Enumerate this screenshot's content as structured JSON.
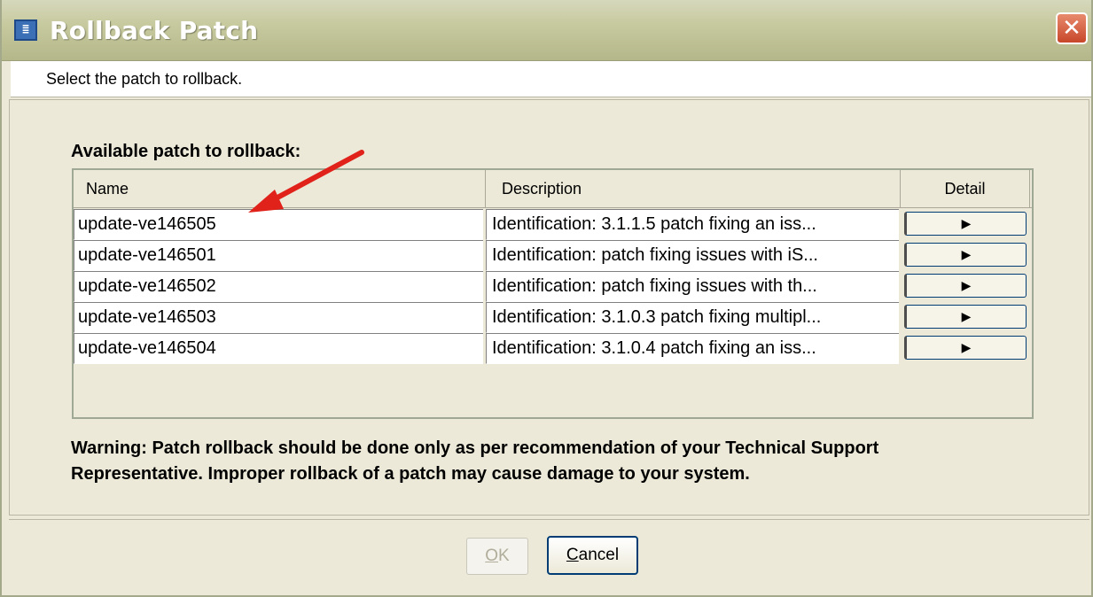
{
  "window": {
    "title": "Rollback Patch",
    "icon": "window-app-icon",
    "close_glyph": "✕"
  },
  "banner": {
    "text": "Select the patch to rollback."
  },
  "section": {
    "label": "Available patch to rollback:"
  },
  "table": {
    "columns": [
      "Name",
      "Description",
      "Detail"
    ],
    "rows": [
      {
        "name": "update-ve146505",
        "description": "Identification: 3.1.1.5 patch fixing an iss..."
      },
      {
        "name": "update-ve146501",
        "description": "Identification: patch fixing issues with iS..."
      },
      {
        "name": "update-ve146502",
        "description": "Identification: patch fixing issues with th..."
      },
      {
        "name": "update-ve146503",
        "description": "Identification: 3.1.0.3 patch fixing multipl..."
      },
      {
        "name": "update-ve146504",
        "description": "Identification: 3.1.0.4 patch fixing an iss..."
      }
    ],
    "detail_glyph": "▶"
  },
  "warning": {
    "line1": "Warning: Patch rollback should be done only as per recommendation of your Technical Support",
    "line2": "Representative. Improper rollback of a patch may cause damage to your system."
  },
  "buttons": {
    "ok_first": "O",
    "ok_rest": "K",
    "cancel_first": "C",
    "cancel_rest": "ancel"
  },
  "colors": {
    "annotation_arrow": "#e0221b"
  }
}
